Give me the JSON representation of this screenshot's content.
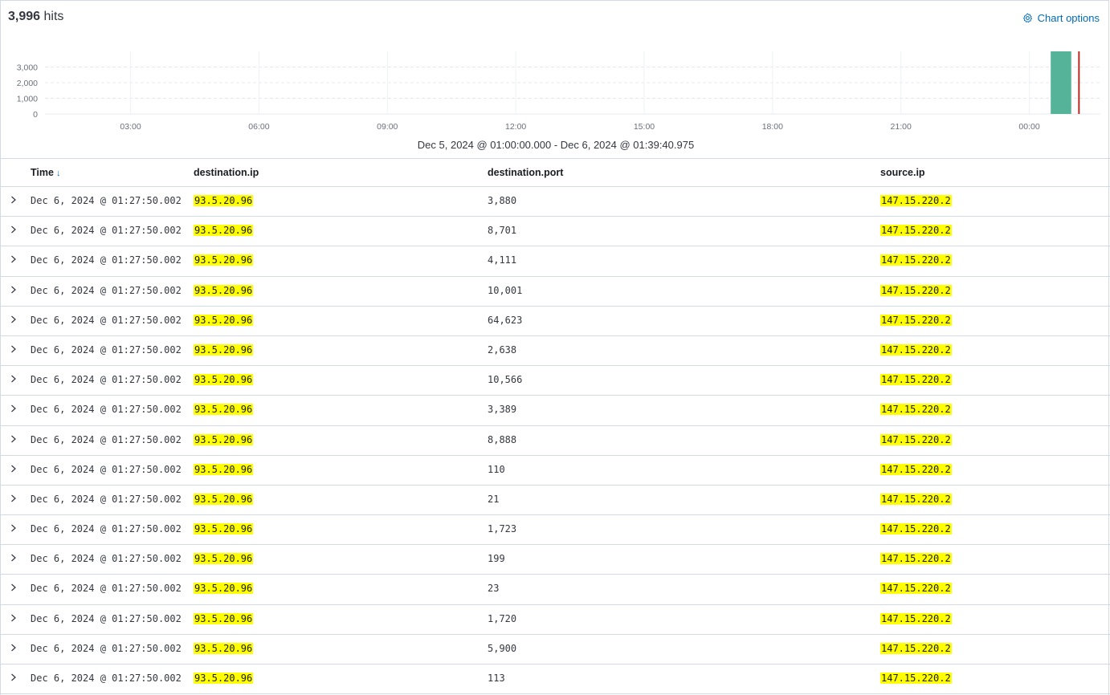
{
  "header": {
    "hits_count": "3,996",
    "hits_label": "hits",
    "chart_options_label": "Chart options"
  },
  "chart_data": {
    "type": "bar",
    "x_tick_labels": [
      "03:00",
      "06:00",
      "09:00",
      "12:00",
      "15:00",
      "18:00",
      "21:00",
      "00:00"
    ],
    "y_tick_labels": [
      "3,000",
      "2,000",
      "1,000",
      "0"
    ],
    "y_ticks": [
      3000,
      2000,
      1000,
      0
    ],
    "ylim": [
      0,
      3996
    ],
    "xlim_hours": [
      1,
      25.66
    ],
    "x_tick_hours": [
      3,
      6,
      9,
      12,
      15,
      18,
      21,
      24
    ],
    "bars": [
      {
        "start_hour": 24.5,
        "end_hour": 24.98,
        "value": 3996
      }
    ],
    "now_marker_hour": 25.16,
    "grid": true,
    "bar_color": "#54b399",
    "marker_color": "#bd271e"
  },
  "time_range": "Dec 5, 2024 @ 01:00:00.000 - Dec 6, 2024 @ 01:39:40.975",
  "table": {
    "columns": [
      "Time",
      "destination.ip",
      "destination.port",
      "source.ip"
    ],
    "rows": [
      {
        "time": "Dec 6, 2024 @ 01:27:50.002",
        "dest_ip": "93.5.20.96",
        "dest_port": "3,880",
        "src_ip": "147.15.220.2"
      },
      {
        "time": "Dec 6, 2024 @ 01:27:50.002",
        "dest_ip": "93.5.20.96",
        "dest_port": "8,701",
        "src_ip": "147.15.220.2"
      },
      {
        "time": "Dec 6, 2024 @ 01:27:50.002",
        "dest_ip": "93.5.20.96",
        "dest_port": "4,111",
        "src_ip": "147.15.220.2"
      },
      {
        "time": "Dec 6, 2024 @ 01:27:50.002",
        "dest_ip": "93.5.20.96",
        "dest_port": "10,001",
        "src_ip": "147.15.220.2"
      },
      {
        "time": "Dec 6, 2024 @ 01:27:50.002",
        "dest_ip": "93.5.20.96",
        "dest_port": "64,623",
        "src_ip": "147.15.220.2"
      },
      {
        "time": "Dec 6, 2024 @ 01:27:50.002",
        "dest_ip": "93.5.20.96",
        "dest_port": "2,638",
        "src_ip": "147.15.220.2"
      },
      {
        "time": "Dec 6, 2024 @ 01:27:50.002",
        "dest_ip": "93.5.20.96",
        "dest_port": "10,566",
        "src_ip": "147.15.220.2"
      },
      {
        "time": "Dec 6, 2024 @ 01:27:50.002",
        "dest_ip": "93.5.20.96",
        "dest_port": "3,389",
        "src_ip": "147.15.220.2"
      },
      {
        "time": "Dec 6, 2024 @ 01:27:50.002",
        "dest_ip": "93.5.20.96",
        "dest_port": "8,888",
        "src_ip": "147.15.220.2"
      },
      {
        "time": "Dec 6, 2024 @ 01:27:50.002",
        "dest_ip": "93.5.20.96",
        "dest_port": "110",
        "src_ip": "147.15.220.2"
      },
      {
        "time": "Dec 6, 2024 @ 01:27:50.002",
        "dest_ip": "93.5.20.96",
        "dest_port": "21",
        "src_ip": "147.15.220.2"
      },
      {
        "time": "Dec 6, 2024 @ 01:27:50.002",
        "dest_ip": "93.5.20.96",
        "dest_port": "1,723",
        "src_ip": "147.15.220.2"
      },
      {
        "time": "Dec 6, 2024 @ 01:27:50.002",
        "dest_ip": "93.5.20.96",
        "dest_port": "199",
        "src_ip": "147.15.220.2"
      },
      {
        "time": "Dec 6, 2024 @ 01:27:50.002",
        "dest_ip": "93.5.20.96",
        "dest_port": "23",
        "src_ip": "147.15.220.2"
      },
      {
        "time": "Dec 6, 2024 @ 01:27:50.002",
        "dest_ip": "93.5.20.96",
        "dest_port": "1,720",
        "src_ip": "147.15.220.2"
      },
      {
        "time": "Dec 6, 2024 @ 01:27:50.002",
        "dest_ip": "93.5.20.96",
        "dest_port": "5,900",
        "src_ip": "147.15.220.2"
      },
      {
        "time": "Dec 6, 2024 @ 01:27:50.002",
        "dest_ip": "93.5.20.96",
        "dest_port": "113",
        "src_ip": "147.15.220.2"
      }
    ]
  },
  "colors": {
    "accent": "#006bb8",
    "highlight": "#ffff00",
    "border": "#d3dae6"
  },
  "icons": {
    "chart_options": "gear-icon",
    "sort": "arrow-down-icon",
    "expand": "chevron-right-icon"
  }
}
